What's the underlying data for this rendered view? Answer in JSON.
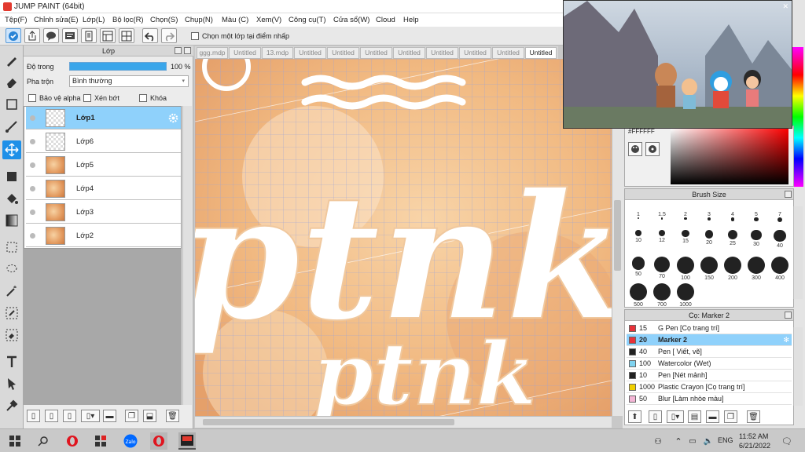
{
  "window": {
    "title": "JUMP PAINT (64bit)"
  },
  "menu": [
    "Tệp(F)",
    "Chỉnh sửa(E)",
    "Lớp(L)",
    "Bộ lọc(R)",
    "Chọn(S)",
    "Chụp(N)",
    "Màu (C)",
    "Xem(V)",
    "Công cụ(T)",
    "Cửa sổ(W)",
    "Cloud",
    "Help"
  ],
  "toolbar": {
    "sample_merged_label": "Chọn một lớp tại điểm nhấp"
  },
  "layer_panel": {
    "title": "Lớp",
    "opacity_label": "Độ trong",
    "opacity_value": "100 %",
    "opacity_level": 100,
    "blend_label": "Pha trộn",
    "blend_value": "Bình thường",
    "protect_alpha": "Bảo vệ alpha",
    "clipping": "Xén bớt",
    "lock": "Khóa",
    "layers": [
      {
        "name": "Lớp1",
        "selected": true,
        "thumb": "checker"
      },
      {
        "name": "Lớp6",
        "selected": false,
        "thumb": "checker"
      },
      {
        "name": "Lớp5",
        "selected": false,
        "thumb": "photo"
      },
      {
        "name": "Lớp4",
        "selected": false,
        "thumb": "photo"
      },
      {
        "name": "Lớp3",
        "selected": false,
        "thumb": "photo"
      },
      {
        "name": "Lớp2",
        "selected": false,
        "thumb": "photo"
      }
    ]
  },
  "tabs": [
    "ggg.mdp",
    "Untitled",
    "13.mdp",
    "Untitled",
    "Untitled",
    "Untitled",
    "Untitled",
    "Untitled",
    "Untitled",
    "Untitled",
    "Untitled"
  ],
  "color_panel": {
    "hex": "#FFFFFF"
  },
  "brush_size_panel": {
    "title": "Brush Size",
    "sizes": [
      "1",
      "1.5",
      "2",
      "3",
      "4",
      "5",
      "7",
      "10",
      "12",
      "15",
      "20",
      "25",
      "30",
      "40",
      "50",
      "70",
      "100",
      "150",
      "200",
      "300",
      "400",
      "500",
      "700",
      "1000"
    ]
  },
  "brush_panel": {
    "title": "Cọ: Marker 2",
    "brushes": [
      {
        "size": "15",
        "name": "G Pen [Cọ trang trí]",
        "color": "#e8323a",
        "selected": false
      },
      {
        "size": "20",
        "name": "Marker 2",
        "color": "#e8323a",
        "selected": true
      },
      {
        "size": "40",
        "name": "Pen [ Viết, vẽ]",
        "color": "#222222",
        "selected": false
      },
      {
        "size": "100",
        "name": "Watercolor (Wet)",
        "color": "#7fd3f0",
        "selected": false
      },
      {
        "size": "10",
        "name": "Pen [Nét mảnh]",
        "color": "#222222",
        "selected": false
      },
      {
        "size": "1000",
        "name": "Plastic Crayon [Cọ trang trí]",
        "color": "#f0d000",
        "selected": false
      },
      {
        "size": "50",
        "name": "Blur [Làm nhòe màu]",
        "color": "#f5b6d6",
        "selected": false
      }
    ]
  },
  "canvas": {
    "text_large": "ptnk",
    "text_small": "ptnk"
  },
  "taskbar": {
    "language": "ENG",
    "time": "11:52 AM",
    "date": "6/21/2022",
    "colors": {
      "opera": "#e0151f",
      "zalo": "#0068ff"
    }
  }
}
